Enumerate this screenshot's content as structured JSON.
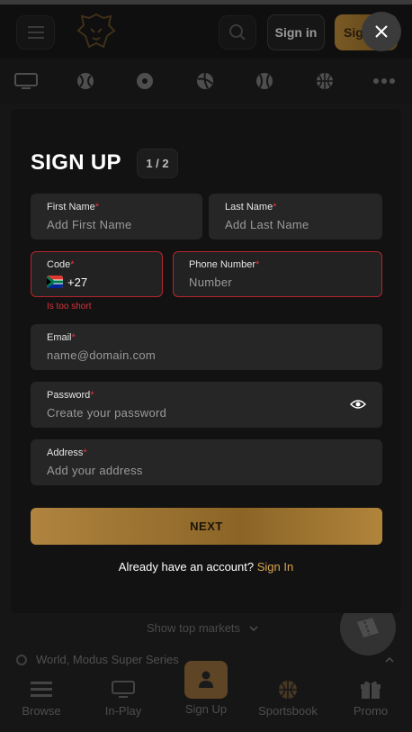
{
  "header": {
    "signin_label": "Sign in",
    "signup_label": "Sig"
  },
  "sports": [
    "live-icon",
    "tennis-ball-icon",
    "soccer-ball-icon",
    "volleyball-icon",
    "baseball-icon",
    "basketball-icon",
    "more-icon"
  ],
  "form": {
    "title": "SIGN UP",
    "step": "1 / 2",
    "first_name": {
      "label": "First Name",
      "required": "*",
      "placeholder": "Add First Name"
    },
    "last_name": {
      "label": "Last Name",
      "required": "*",
      "placeholder": "Add Last Name"
    },
    "code": {
      "label": "Code",
      "required": "*",
      "value": "+27",
      "error": "Is too short"
    },
    "phone": {
      "label": "Phone Number",
      "required": "*",
      "placeholder": "Number"
    },
    "email": {
      "label": "Email",
      "required": "*",
      "placeholder": "name@domain.com"
    },
    "password": {
      "label": "Password",
      "required": "*",
      "placeholder": "Create your password"
    },
    "address": {
      "label": "Address",
      "required": "*",
      "placeholder": "Add your address"
    },
    "next_label": "NEXT",
    "already_text": "Already have an account?",
    "signin_link": "Sign In"
  },
  "background": {
    "show_top_markets": "Show top markets",
    "league": "World, Modus Super Series"
  },
  "bottom_nav": [
    {
      "label": "Browse",
      "icon": "browse-icon"
    },
    {
      "label": "In-Play",
      "icon": "live-icon"
    },
    {
      "label": "Sign Up",
      "icon": "user-icon"
    },
    {
      "label": "Sportsbook",
      "icon": "basketball-icon"
    },
    {
      "label": "Promo",
      "icon": "gift-icon"
    }
  ],
  "colors": {
    "accent_gold": "#b0843f",
    "error_red": "#d8333a",
    "field_bg": "#262626",
    "modal_bg": "#121212"
  }
}
